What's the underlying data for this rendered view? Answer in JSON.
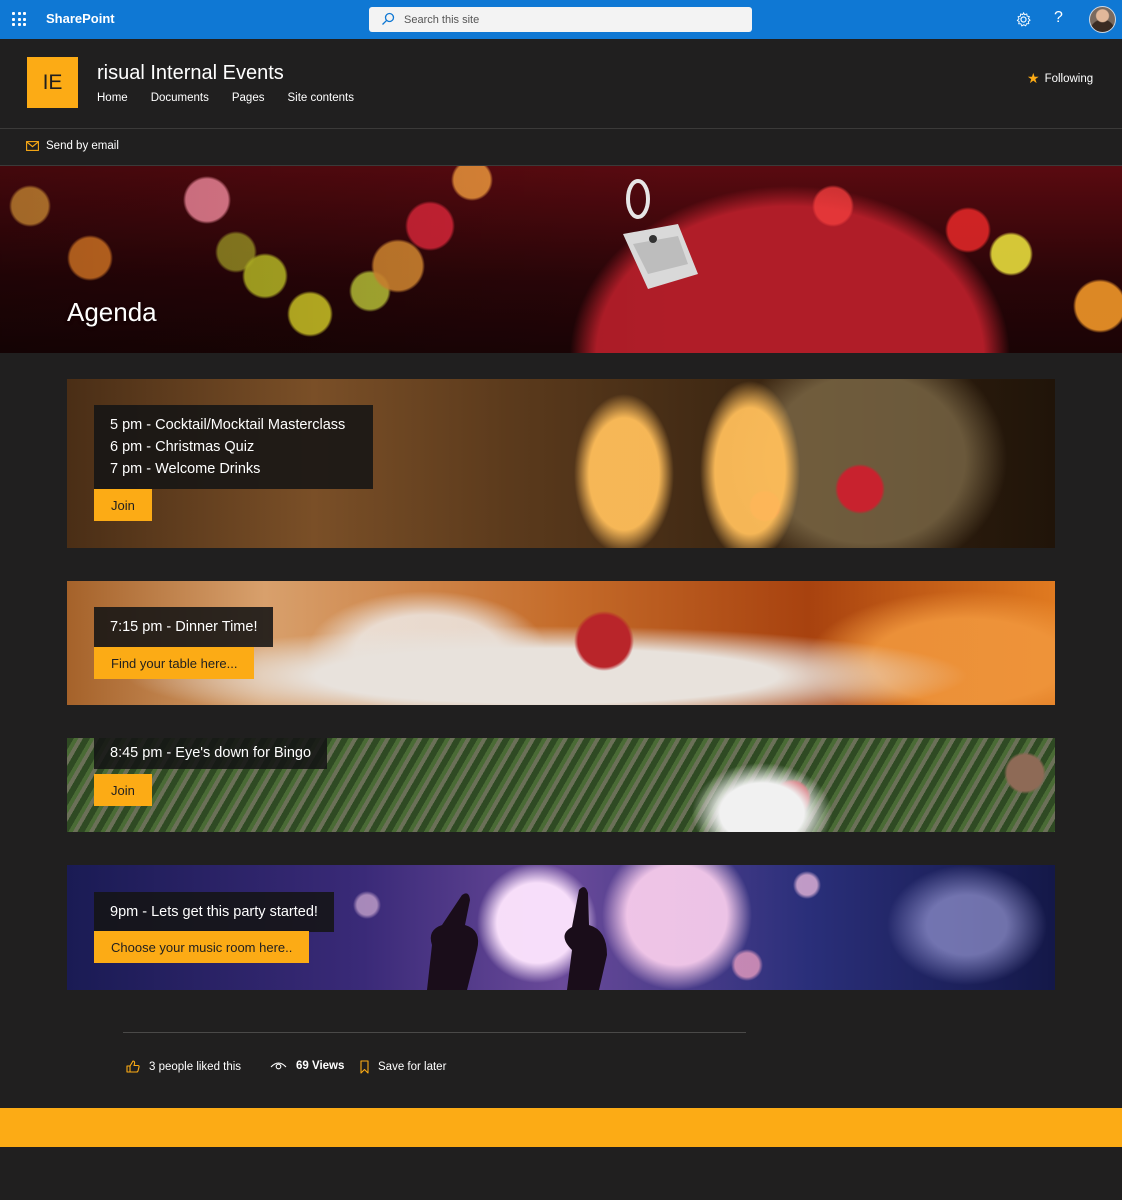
{
  "suite": {
    "brand": "SharePoint",
    "search_placeholder": "Search this site"
  },
  "site": {
    "logo_text": "IE",
    "title": "risual Internal Events",
    "nav": [
      "Home",
      "Documents",
      "Pages",
      "Site contents"
    ],
    "following_label": "Following"
  },
  "command_bar": {
    "send_email_label": "Send by email"
  },
  "hero": {
    "title": "Agenda"
  },
  "agenda": [
    {
      "lines": [
        "5 pm - Cocktail/Mocktail Masterclass",
        "6 pm - Christmas Quiz",
        "7 pm - Welcome Drinks"
      ],
      "button": "Join"
    },
    {
      "lines": [
        "7:15 pm - Dinner Time!"
      ],
      "button": "Find your table here..."
    },
    {
      "lines": [
        "8:45 pm - Eye's down for Bingo"
      ],
      "button": "Join"
    },
    {
      "lines": [
        "9pm - Lets get this party started!"
      ],
      "button": "Choose your music room here.."
    }
  ],
  "engagement": {
    "likes_label": "3 people liked this",
    "views_label": "69 Views",
    "save_label": "Save for later"
  },
  "colors": {
    "suite_bar": "#0f78d4",
    "accent": "#fcab15",
    "background": "#201f1f"
  }
}
